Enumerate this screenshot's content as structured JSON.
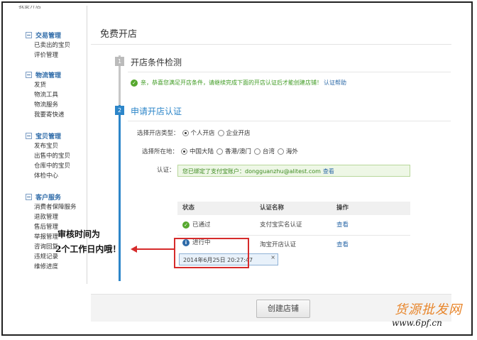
{
  "sidebar": {
    "cut_item": "我要开店",
    "groups": [
      {
        "title": "交易管理",
        "items": [
          "已卖出的宝贝",
          "评价管理"
        ]
      },
      {
        "title": "物流管理",
        "items": [
          "发货",
          "物流工具",
          "物流服务",
          "我要寄快递"
        ]
      },
      {
        "title": "宝贝管理",
        "items": [
          "发布宝贝",
          "出售中的宝贝",
          "仓库中的宝贝",
          "体检中心"
        ]
      },
      {
        "title": "客户服务",
        "items": [
          "消费者保障服务",
          "退款管理",
          "售后管理",
          "举报管理",
          "咨询回复",
          "违规记录",
          "维修进度"
        ]
      }
    ]
  },
  "page": {
    "title": "免费开店"
  },
  "step1": {
    "number": "1",
    "title": "开店条件检测",
    "message": "亲，恭喜您满足开店条件，请继续完成下面的开店认证后才能创建店铺！",
    "link": "认证帮助"
  },
  "step2": {
    "number": "2",
    "title": "申请开店认证",
    "shop_type": {
      "label": "选择开店类型：",
      "options": [
        "个人开店",
        "企业开店"
      ],
      "selected": "个人开店"
    },
    "location": {
      "label": "选择所在地：",
      "options": [
        "中国大陆",
        "香港/澳门",
        "台湾",
        "海外"
      ],
      "selected": "中国大陆"
    },
    "verify": {
      "label": "认证：",
      "text": "您已绑定了支付宝账户：dongguanzhu@alitest.com",
      "link": "查看"
    },
    "table": {
      "headers": [
        "状态",
        "认证名称",
        "操作"
      ],
      "rows": [
        {
          "status": "已通过",
          "name": "支付宝实名认证",
          "action": "查看"
        },
        {
          "status": "进行中",
          "name": "淘宝开店认证",
          "action": "查看"
        }
      ],
      "tooltip": "2014年6月25日 20:27:47",
      "tooltip_close": "×"
    }
  },
  "annotation": {
    "line1": "审核时间为",
    "line2": "2个工作日内哦！"
  },
  "footer": {
    "create_button": "创建店铺"
  },
  "watermark": {
    "line1": "货源批发网",
    "line2": "www.6pf.cn"
  },
  "colors": {
    "accent": "#2d86c9",
    "success": "#56a82e",
    "annotation": "#d62b2b",
    "watermark": "#e8852a"
  }
}
